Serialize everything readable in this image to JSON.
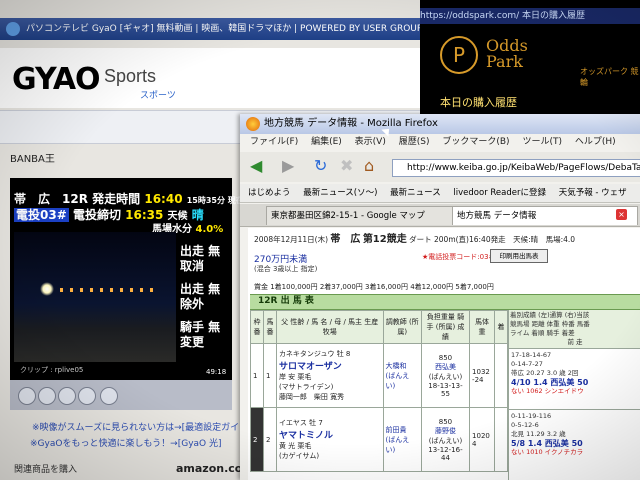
{
  "gyao": {
    "window_title": "パソコンテレビ GyaO [ギャオ] 無料動画 | 映画、韓国ドラマほか | POWERED BY USER GROUP - Micro",
    "logo_text": "GYAO",
    "sports_title": "Sports",
    "sports_sub": "スポーツ",
    "section_label": "BANBA王",
    "player": {
      "line1_left": "帯　広　12R",
      "line1_mid": "発走時間",
      "line1_time": "16:40",
      "line1_right": "15時35分 現在",
      "line2_left": "電投03#",
      "line2_mid": "電投締切",
      "line2_time": "16:35",
      "weather_label": "天候",
      "weather_val": "晴",
      "water_label": "馬場水分",
      "water_val": "4.0%",
      "side1": "出走 無",
      "side1b": "取消",
      "side2": "出走 無",
      "side2b": "除外",
      "side3": "騎手 無",
      "side3b": "変更",
      "clip_label": "クリップ : rplive05",
      "time_display": "49:18"
    },
    "link1": "※映像がスムーズに見られない方は→[最適設定ガイド]",
    "link2": "※GyaOをもっと快適に楽しもう！→[GyaO 光]",
    "related": "関連商品を購入",
    "amazon": "amazon.co.jp"
  },
  "odds": {
    "url": "https://oddspark.com/ 本日の購入履歴",
    "logo_letter": "P",
    "brand_line1": "Odds",
    "brand_line2": "Park",
    "brand_sub": "オッズパーク 競輪",
    "buy_history": "本日の購入履歴"
  },
  "firefox": {
    "title": "地方競馬 データ情報 - Mozilla Firefox",
    "menu": [
      "ファイル(F)",
      "編集(E)",
      "表示(V)",
      "履歴(S)",
      "ブックマーク(B)",
      "ツール(T)",
      "ヘルプ(H)"
    ],
    "url": "http://www.keiba.go.jp/KeibaWeb/PageFlows/DebaTable/DebaTa",
    "bookmarks": [
      "はじめよう",
      "最新ニュース(ソ〜)",
      "最新ニュース",
      "livedoor Readerに登録",
      "天気予報 - ウェザ"
    ],
    "tabs": [
      "東京都墨田区錦2-15-1 - Google マップ",
      "地方競馬 データ情報"
    ]
  },
  "race": {
    "date_line": "2008年12月11日(木)",
    "venue": "帯　広",
    "race_no": "第12競走",
    "detail": "ダート 200m(直)16:40発走　天候:晴　馬場:4.0",
    "class": "270万円未満",
    "conditions": "(混合 3歳以上 指定)",
    "code": "★電話投票コード:03#",
    "print_button": "印刷用出馬表",
    "prize": "賞金 1着100,000円 2着37,000円 3着16,000円 4着12,000円 5着7,000円",
    "section_title": "12R 出 馬 表",
    "headers": [
      "枠番",
      "馬番",
      "父 性齢 / 馬 名 / 母 / 馬主 生産牧場",
      "調教師 (所属)",
      "負担重量 騎手 (所属) 成 績",
      "馬体重",
      "着",
      "着別成績 (左)通算 (右)当該",
      "前走"
    ],
    "rows": [
      {
        "waku": "1",
        "uma": "1",
        "sire": "カネキタンジュウ",
        "sex": "牡 8",
        "name": "サロマオーザン",
        "dam": "岸 安",
        "color": "栗毛",
        "owner": "(マサトライデン)",
        "breeder": "藤岡一郎　柴田 寛秀",
        "trainer": "大橋和",
        "trainer_aff": "(ばんえい)",
        "weight": "850",
        "jockey": "西弘美",
        "jockey_aff": "(ばんえい)",
        "record": "18-13-13-55",
        "body": "1032",
        "delta": "-24",
        "stats1": "17-18-14-67",
        "stats2": "0-14-7-27"
      },
      {
        "waku": "2",
        "uma": "2",
        "sire": "イエヤス",
        "sex": "牡 7",
        "name": "ヤマトミノル",
        "dam": "黄 光",
        "color": "栗毛",
        "owner": "(カゲイサム)",
        "breeder": "",
        "trainer": "前田貴",
        "trainer_aff": "(ばんえい)",
        "weight": "850",
        "jockey": "藤野俊",
        "jockey_aff": "(ばんえい)",
        "record": "13-12-16-44",
        "body": "1020",
        "delta": "4",
        "stats1": "0-11-19-116",
        "stats2": "0-5-12-6"
      }
    ],
    "right_panel": {
      "head1": "競馬場 距離 体重 枠番 馬番",
      "head2": "ライム 着順 騎手 着差",
      "head3": "前 走",
      "row1_a": "帯広 20.27 3.0 歳 2回",
      "row1_b": "4/10 1.4 西弘美 50",
      "row1_c": "ない 1062 シンエイドウ",
      "row2_a": "北見 11.29 3.2 歳",
      "row2_b": "5/8 1.4 西弘美 50",
      "row2_c": "ない 1010 イクノチカラ"
    }
  }
}
